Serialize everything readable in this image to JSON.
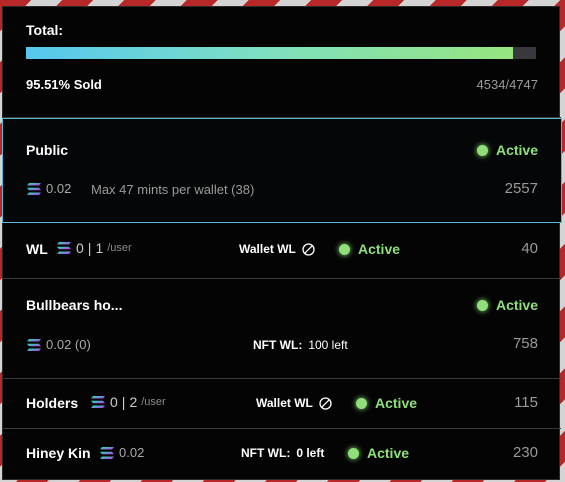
{
  "total": {
    "label": "Total:",
    "sold_pct_text": "95.51% Sold",
    "sold_fraction": 0.9551,
    "sold_count": "4534/4747"
  },
  "colors": {
    "accent_green": "#8fe07a",
    "accent_blue": "#55c7f0",
    "selected_border": "#5ab8d8"
  },
  "phases": [
    {
      "name": "Public",
      "status": "Active",
      "price": "0.02",
      "note": "Max 47 mints per wallet (38)",
      "count": "2557",
      "icon": "solana-icon"
    },
    {
      "name": "WL",
      "price_left": "0",
      "sep": "|",
      "limit": "1",
      "per": "/user",
      "wl_label": "Wallet WL",
      "wl_icon": "ban-icon",
      "status": "Active",
      "count": "40"
    },
    {
      "name": "Bullbears ho...",
      "status": "Active",
      "price": "0.02 (0)",
      "nft_wl_label": "NFT WL:",
      "nft_wl_value": "100 left",
      "count": "758"
    },
    {
      "name": "Holders",
      "price_left": "0",
      "sep": "|",
      "limit": "2",
      "per": "/user",
      "wl_label": "Wallet WL",
      "status": "Active",
      "count": "115"
    },
    {
      "name": "Hiney Kin",
      "price": "0.02",
      "nft_wl_label": "NFT WL:",
      "nft_wl_value": "0 left",
      "status": "Active",
      "count": "230"
    }
  ]
}
